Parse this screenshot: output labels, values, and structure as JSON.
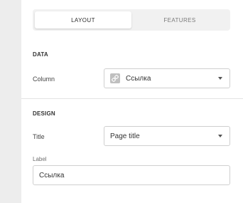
{
  "tabs": [
    {
      "label": "LAYOUT",
      "active": true
    },
    {
      "label": "FEATURES",
      "active": false
    }
  ],
  "data_section": {
    "title": "DATA",
    "column": {
      "label": "Column",
      "value": "Ссылка",
      "icon": "link-icon"
    }
  },
  "design_section": {
    "title": "DESIGN",
    "title_field": {
      "label": "Title",
      "value": "Page title"
    },
    "label_field": {
      "label": "Label",
      "value": "Ссылка"
    }
  },
  "colors": {
    "panel_bg": "#ffffff",
    "page_bg": "#ececec",
    "border": "#cfcfcf"
  }
}
